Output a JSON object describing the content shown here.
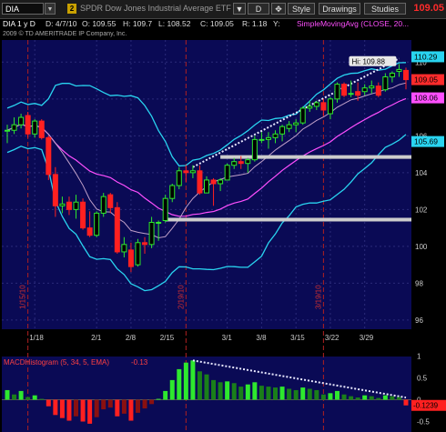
{
  "toolbar": {
    "symbol": "DIA",
    "link_badge": "2",
    "instrument_name": "SPDR Dow Jones Industrial Average ETF ...",
    "period_button": "D",
    "style_button": "Style",
    "drawings_button": "Drawings",
    "studies_button": "Studies",
    "last_price": "109.05"
  },
  "info_bar": {
    "symbol_period": "DIA 1 y D",
    "date": "D: 4/7/10",
    "open": "O: 109.55",
    "high": "H: 109.7",
    "low": "L: 108.52",
    "close": "C: 109.05",
    "range": "R: 1.18",
    "y": "Y:",
    "study": "SimpleMovingAvg (CLOSE, 20..."
  },
  "copyright": "2009 © TD AMERITRADE IP Company, Inc.",
  "price_panel": {
    "y_ticks": [
      "110",
      "108",
      "106",
      "104",
      "102",
      "100",
      "98",
      "96"
    ],
    "hi_label": "Hi: 109.88",
    "price_tags": [
      {
        "value": "110.29",
        "color": "#29d4f0"
      },
      {
        "value": "109.05",
        "color": "#ff2b2b"
      },
      {
        "value": "108.06",
        "color": "#ff4fff"
      },
      {
        "value": "105.69",
        "color": "#29d4f0"
      }
    ],
    "date_markers": [
      "1/15/10",
      "2/19/10",
      "3/19/10"
    ],
    "x_ticks": [
      "1/18",
      "2/1",
      "2/8",
      "2/15",
      "3/1",
      "3/8",
      "3/15",
      "3/22",
      "3/29"
    ]
  },
  "macd_panel": {
    "label": "MACDHistogram (5, 34, 5, EMA)",
    "value": "-0.13",
    "y_ticks": [
      "1",
      "0.5",
      "0",
      "-0.5"
    ],
    "last_tag": "-0.1239"
  },
  "chart_data": {
    "type": "candlestick",
    "symbol": "DIA",
    "y_axis_range": [
      95.5,
      111.2
    ],
    "x_dates": [
      "1/12",
      "1/13",
      "1/14",
      "1/15",
      "1/19",
      "1/20",
      "1/21",
      "1/22",
      "1/25",
      "1/26",
      "1/27",
      "1/28",
      "1/29",
      "2/1",
      "2/2",
      "2/3",
      "2/4",
      "2/5",
      "2/8",
      "2/9",
      "2/10",
      "2/11",
      "2/12",
      "2/16",
      "2/17",
      "2/18",
      "2/19",
      "2/22",
      "2/23",
      "2/24",
      "2/25",
      "2/26",
      "3/1",
      "3/2",
      "3/3",
      "3/4",
      "3/5",
      "3/8",
      "3/9",
      "3/10",
      "3/11",
      "3/12",
      "3/15",
      "3/16",
      "3/17",
      "3/18",
      "3/19",
      "3/22",
      "3/23",
      "3/24",
      "3/25",
      "3/26",
      "3/29",
      "3/30",
      "3/31",
      "4/1",
      "4/5",
      "4/6",
      "4/7"
    ],
    "ohlc": [
      [
        106.3,
        106.6,
        105.6,
        106.3
      ],
      [
        106.3,
        107.0,
        106.1,
        106.6
      ],
      [
        106.6,
        107.2,
        106.4,
        107.0
      ],
      [
        107.1,
        107.3,
        105.9,
        106.1
      ],
      [
        106.1,
        106.9,
        105.9,
        106.8
      ],
      [
        106.8,
        106.9,
        105.8,
        105.9
      ],
      [
        105.9,
        106.0,
        103.6,
        103.9
      ],
      [
        103.9,
        104.3,
        101.6,
        102.2
      ],
      [
        102.2,
        102.7,
        101.8,
        102.3
      ],
      [
        102.4,
        102.7,
        101.7,
        102.0
      ],
      [
        102.0,
        102.8,
        101.5,
        102.4
      ],
      [
        102.4,
        102.6,
        100.9,
        101.0
      ],
      [
        101.0,
        101.9,
        100.5,
        100.6
      ],
      [
        100.6,
        101.9,
        100.5,
        101.8
      ],
      [
        101.8,
        102.9,
        101.6,
        102.7
      ],
      [
        102.8,
        102.9,
        101.8,
        102.1
      ],
      [
        102.1,
        102.4,
        99.6,
        99.7
      ],
      [
        99.7,
        100.5,
        99.4,
        100.1
      ],
      [
        99.8,
        100.2,
        98.6,
        98.9
      ],
      [
        99.0,
        100.4,
        98.9,
        100.2
      ],
      [
        100.2,
        100.5,
        99.6,
        100.1
      ],
      [
        100.1,
        101.6,
        99.9,
        101.3
      ],
      [
        101.3,
        101.4,
        100.3,
        101.3
      ],
      [
        101.4,
        102.8,
        101.3,
        102.6
      ],
      [
        102.6,
        103.4,
        102.4,
        103.3
      ],
      [
        103.3,
        104.3,
        103.1,
        104.1
      ],
      [
        104.1,
        104.4,
        103.5,
        104.0
      ],
      [
        104.0,
        104.4,
        103.7,
        104.1
      ],
      [
        104.1,
        104.4,
        102.8,
        102.9
      ],
      [
        102.9,
        103.8,
        102.9,
        103.6
      ],
      [
        103.6,
        103.7,
        102.2,
        103.4
      ],
      [
        103.4,
        103.7,
        103.0,
        103.6
      ],
      [
        103.6,
        104.5,
        103.6,
        104.4
      ],
      [
        104.4,
        104.8,
        104.2,
        104.6
      ],
      [
        104.6,
        104.9,
        104.2,
        104.5
      ],
      [
        104.5,
        104.8,
        104.0,
        104.7
      ],
      [
        104.7,
        106.0,
        104.6,
        105.8
      ],
      [
        105.8,
        106.2,
        105.6,
        105.8
      ],
      [
        105.8,
        106.2,
        105.3,
        105.9
      ],
      [
        105.9,
        106.3,
        105.6,
        106.1
      ],
      [
        106.1,
        106.6,
        105.7,
        106.5
      ],
      [
        106.4,
        106.8,
        106.2,
        106.6
      ],
      [
        106.6,
        106.9,
        106.2,
        106.7
      ],
      [
        106.7,
        107.6,
        106.6,
        107.5
      ],
      [
        107.5,
        107.9,
        107.3,
        107.6
      ],
      [
        107.6,
        107.9,
        107.4,
        107.8
      ],
      [
        107.8,
        108.0,
        107.1,
        107.4
      ],
      [
        107.2,
        108.1,
        106.9,
        108.0
      ],
      [
        108.0,
        108.9,
        107.8,
        108.8
      ],
      [
        108.8,
        108.9,
        108.1,
        108.2
      ],
      [
        108.3,
        109.0,
        108.1,
        108.3
      ],
      [
        108.4,
        108.9,
        107.9,
        108.2
      ],
      [
        108.4,
        108.8,
        108.2,
        108.6
      ],
      [
        108.6,
        109.0,
        108.3,
        108.7
      ],
      [
        108.7,
        108.9,
        108.1,
        108.2
      ],
      [
        108.5,
        109.4,
        108.4,
        109.2
      ],
      [
        109.2,
        109.5,
        108.9,
        109.4
      ],
      [
        109.5,
        109.9,
        109.2,
        109.6
      ],
      [
        109.55,
        109.7,
        108.52,
        109.05
      ]
    ],
    "moving_averages": [
      {
        "name": "SimpleMovingAvg (CLOSE, 20...)",
        "color": "#ff4fff"
      },
      {
        "name": "",
        "color": "#c0a0c8"
      }
    ],
    "bollinger_color": "#29d4f0",
    "macd_histogram": [
      0.22,
      0.12,
      0.2,
      0.06,
      0.1,
      0.02,
      -0.15,
      -0.35,
      -0.42,
      -0.48,
      -0.38,
      -0.5,
      -0.55,
      -0.4,
      -0.22,
      -0.18,
      -0.38,
      -0.32,
      -0.48,
      -0.3,
      -0.2,
      -0.1,
      0.02,
      0.2,
      0.45,
      0.7,
      0.85,
      0.9,
      0.65,
      0.58,
      0.45,
      0.4,
      0.42,
      0.38,
      0.3,
      0.35,
      0.4,
      0.32,
      0.3,
      0.28,
      0.3,
      0.25,
      0.22,
      0.28,
      0.25,
      0.22,
      0.12,
      0.15,
      0.2,
      0.12,
      0.08,
      0.05,
      0.1,
      0.08,
      0.04,
      0.1,
      0.08,
      0.06,
      -0.13
    ]
  }
}
